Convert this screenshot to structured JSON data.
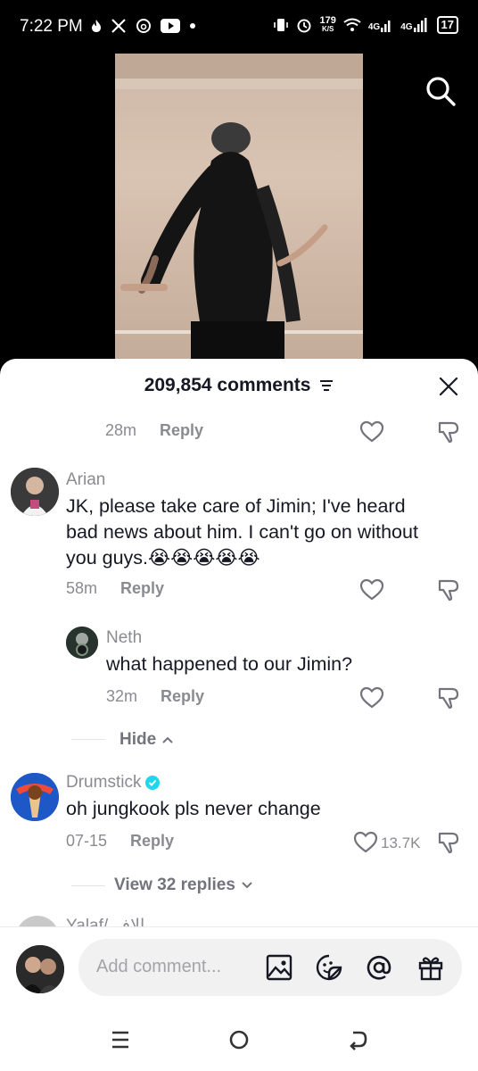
{
  "status_bar": {
    "time": "7:22 PM",
    "net_speed_value": "179",
    "net_speed_unit": "K/S",
    "signal1": "4G",
    "signal2": "4G",
    "battery": "17"
  },
  "sheet": {
    "comment_count_label": "209,854 comments"
  },
  "first_meta": {
    "time": "28m",
    "reply_label": "Reply"
  },
  "comments": [
    {
      "username": "Arian",
      "text_line1": "JK, please take care of Jimin; I've heard",
      "text_line2": "bad news about him. I can't go on without",
      "text_line3": "you guys.",
      "emoji": "😭😭😭😭😭",
      "time": "58m",
      "reply_label": "Reply"
    },
    {
      "username": "Drumstick",
      "text_line1": "oh jungkook pls never change",
      "time": "07-15",
      "reply_label": "Reply",
      "likes": "13.7K",
      "verified": true
    }
  ],
  "reply": {
    "username": "Neth",
    "text": "what happened to our Jimin?",
    "time": "32m",
    "reply_label": "Reply"
  },
  "hide_label": "Hide",
  "view_replies_label": "View 32 replies",
  "partial_username": "Yalaf/ الاف",
  "input": {
    "placeholder": "Add comment..."
  },
  "colors": {
    "verified": "#20d5ec",
    "text": "#161823",
    "muted": "#8a8b91"
  }
}
